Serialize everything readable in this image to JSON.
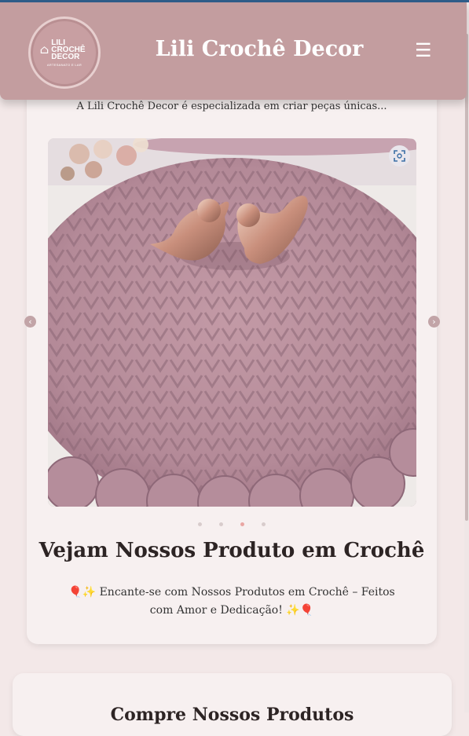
{
  "header": {
    "site_title": "Lili Crochê Decor",
    "logo_text": "LILI CROCHÊ DECOR",
    "logo_subtext": "ARTESANATO E LAR"
  },
  "hero": {
    "intro_text": "A Lili Crochê Decor é especializada em criar peças únicas...",
    "carousel": {
      "slide_count": 4,
      "active_index": 2,
      "image_alt": "crochet doily with rose gold birds"
    }
  },
  "products_section": {
    "title": "Vejam Nossos Produto em Crochê",
    "promo_text": "🎈✨ Encante-se com Nossos Produtos em Crochê – Feitos com Amor e Dedicação! ✨🎈"
  },
  "shop_section": {
    "title": "Compre Nossos Produtos"
  },
  "icons": {
    "menu": "hamburger-menu-icon",
    "zoom": "zoom-expand-icon",
    "prev": "chevron-left-icon",
    "next": "chevron-right-icon"
  },
  "colors": {
    "header_bg": "#c39d9f",
    "page_bg": "#f3e8e8",
    "card_bg": "#f7f0f0",
    "arrow_bg": "#c2a4a7",
    "active_dot": "#e9a6a3"
  }
}
